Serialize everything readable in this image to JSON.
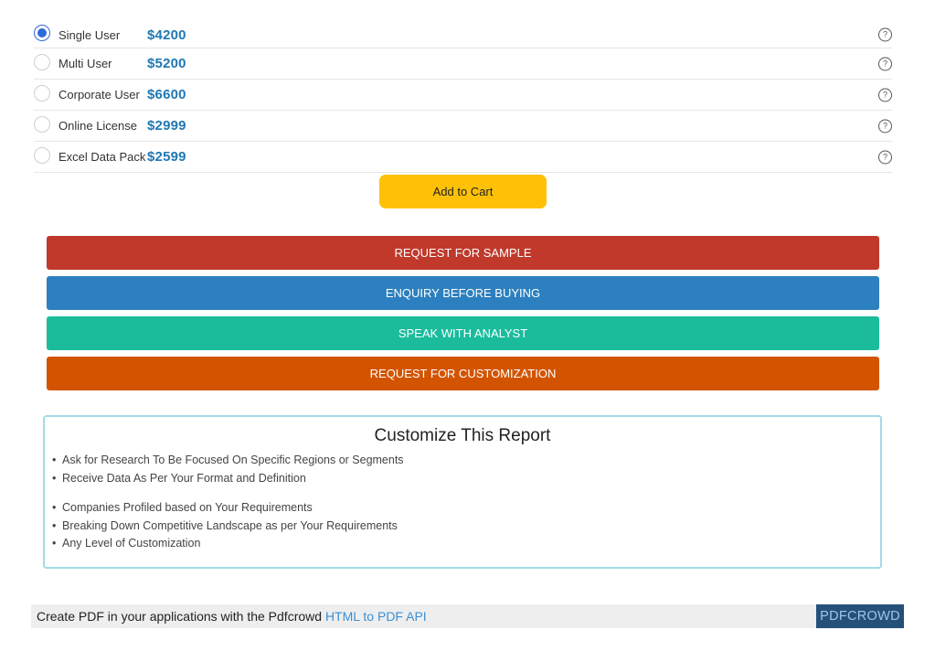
{
  "licenses": [
    {
      "name": "Single User",
      "price": "$4200",
      "selected": true
    },
    {
      "name": "Multi User",
      "price": "$5200",
      "selected": false
    },
    {
      "name": "Corporate User",
      "price": "$6600",
      "selected": false
    },
    {
      "name": "Online License",
      "price": "$2999",
      "selected": false
    },
    {
      "name": "Excel Data Pack",
      "price": "$2599",
      "selected": false
    }
  ],
  "help_icon_glyph": "?",
  "cart": {
    "add_label": "Add to Cart"
  },
  "actions": {
    "sample": "REQUEST FOR SAMPLE",
    "enquiry": "ENQUIRY BEFORE BUYING",
    "analyst": "SPEAK WITH ANALYST",
    "customization": "REQUEST FOR CUSTOMIZATION"
  },
  "colors": {
    "sample": "#c0392b",
    "enquiry": "#2d80bf",
    "analyst": "#1abc9c",
    "customization": "#d35400",
    "cart": "#ffc107",
    "price": "#1f78b4"
  },
  "customize": {
    "title": "Customize This Report",
    "points": [
      "Ask for Research To Be Focused On Specific Regions or Segments",
      "Receive Data As Per Your Format and Definition",
      "Companies Profiled based on Your Requirements",
      "Breaking Down Competitive Landscape as per Your Requirements",
      "Any Level of Customization"
    ]
  },
  "footer": {
    "text": "Create PDF in your applications with the Pdfcrowd ",
    "link": "HTML to PDF API",
    "badge": "PDFCROWD"
  }
}
